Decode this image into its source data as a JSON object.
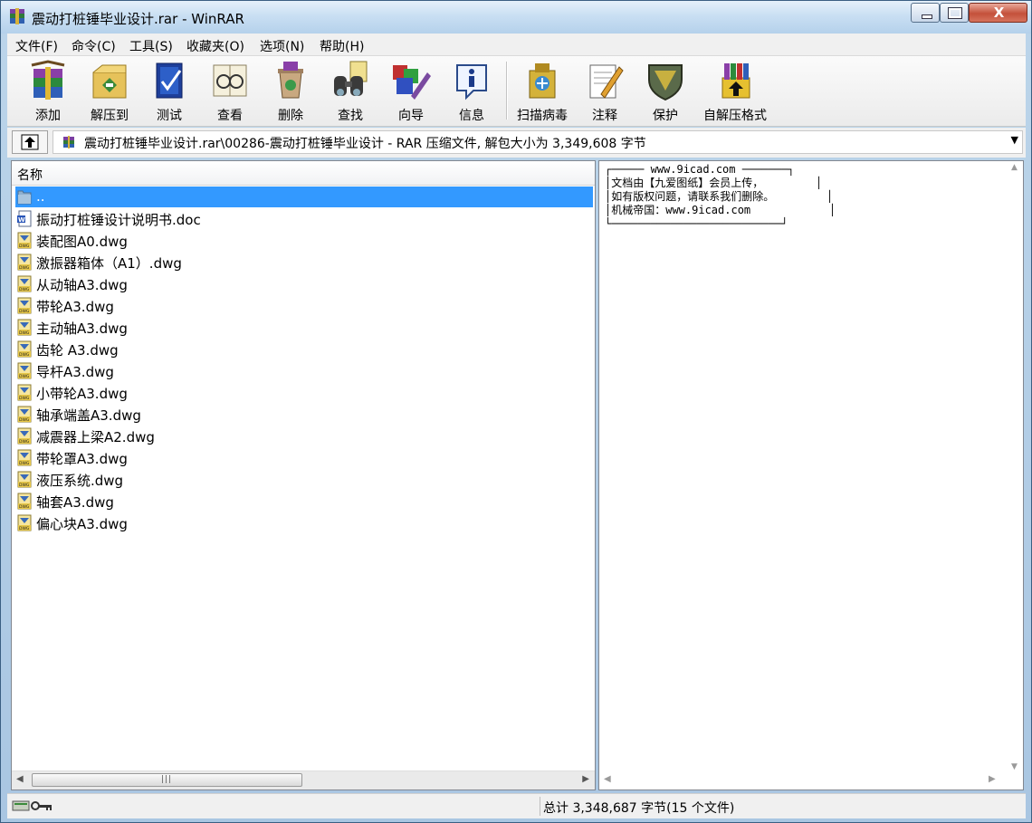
{
  "window": {
    "title": "震动打桩锤毕业设计.rar - WinRAR",
    "close_glyph": "X"
  },
  "menu": [
    {
      "label": "文件(F)"
    },
    {
      "label": "命令(C)"
    },
    {
      "label": "工具(S)"
    },
    {
      "label": "收藏夹(O)"
    },
    {
      "label": "选项(N)"
    },
    {
      "label": "帮助(H)"
    }
  ],
  "toolbar": [
    {
      "label": "添加",
      "icon": "add-archive-icon"
    },
    {
      "label": "解压到",
      "icon": "extract-to-icon"
    },
    {
      "label": "测试",
      "icon": "test-icon"
    },
    {
      "label": "查看",
      "icon": "view-icon"
    },
    {
      "label": "删除",
      "icon": "delete-icon"
    },
    {
      "label": "查找",
      "icon": "find-icon"
    },
    {
      "label": "向导",
      "icon": "wizard-icon"
    },
    {
      "label": "信息",
      "icon": "info-icon"
    },
    {
      "label": "扫描病毒",
      "icon": "virus-scan-icon"
    },
    {
      "label": "注释",
      "icon": "comment-icon"
    },
    {
      "label": "保护",
      "icon": "protect-icon"
    },
    {
      "label": "自解压格式",
      "icon": "sfx-icon"
    }
  ],
  "address": {
    "path": "震动打桩锤毕业设计.rar\\00286-震动打桩锤毕业设计 - RAR 压缩文件, 解包大小为 3,349,608 字节",
    "dropdown_glyph": "▼"
  },
  "file_list": {
    "column_name": "名称",
    "items": [
      {
        "name": "..",
        "type": "parent-folder",
        "selected": true
      },
      {
        "name": "振动打桩锤设计说明书.doc",
        "type": "doc"
      },
      {
        "name": "装配图A0.dwg",
        "type": "dwg"
      },
      {
        "name": "激振器箱体（A1）.dwg",
        "type": "dwg"
      },
      {
        "name": "从动轴A3.dwg",
        "type": "dwg"
      },
      {
        "name": "带轮A3.dwg",
        "type": "dwg"
      },
      {
        "name": "主动轴A3.dwg",
        "type": "dwg"
      },
      {
        "name": "齿轮 A3.dwg",
        "type": "dwg"
      },
      {
        "name": "导杆A3.dwg",
        "type": "dwg"
      },
      {
        "name": "小带轮A3.dwg",
        "type": "dwg"
      },
      {
        "name": "轴承端盖A3.dwg",
        "type": "dwg"
      },
      {
        "name": "减震器上梁A2.dwg",
        "type": "dwg"
      },
      {
        "name": "带轮罩A3.dwg",
        "type": "dwg"
      },
      {
        "name": "液压系统.dwg",
        "type": "dwg"
      },
      {
        "name": "轴套A3.dwg",
        "type": "dwg"
      },
      {
        "name": "偏心块A3.dwg",
        "type": "dwg"
      }
    ]
  },
  "comment": {
    "text": "┌───── www.9icad.com ───────┐\n│文档由【九爱图纸】会员上传，        │\n│如有版权问题，请联系我们删除。        │\n│机械帝国：www.9icad.com            │\n└──────────────────────────┘"
  },
  "statusbar": {
    "summary": "总计 3,348,687 字节(15 个文件)"
  }
}
